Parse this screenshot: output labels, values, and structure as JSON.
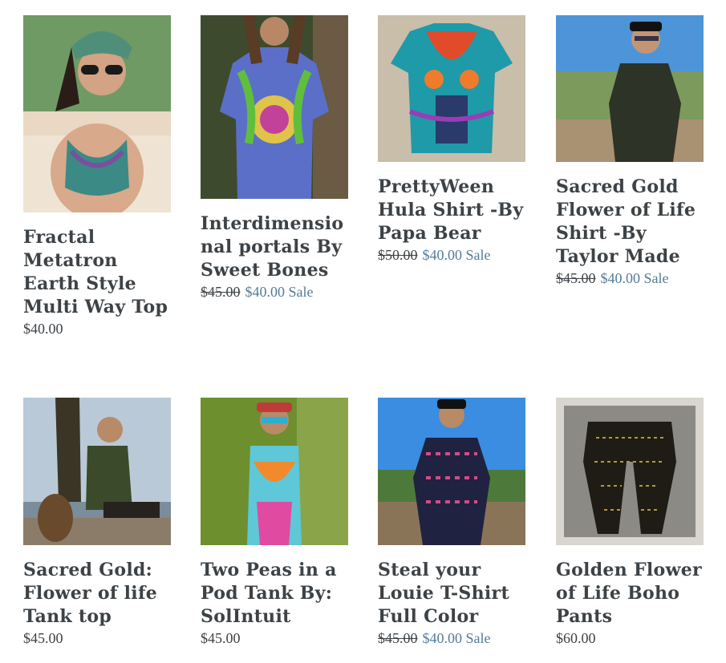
{
  "products": [
    {
      "title": "Fractal Metatron Earth Style Multi Way Top",
      "price": "$40.00"
    },
    {
      "title": "Interdimensional portals By Sweet Bones",
      "compare_price": "$45.00",
      "sale_price": "$40.00",
      "sale_label": "Sale"
    },
    {
      "title": "PrettyWeen Hula Shirt -By Papa Bear",
      "compare_price": "$50.00",
      "sale_price": "$40.00",
      "sale_label": "Sale"
    },
    {
      "title": "Sacred Gold Flower of Life Shirt -By Taylor Made",
      "compare_price": "$45.00",
      "sale_price": "$40.00",
      "sale_label": "Sale"
    },
    {
      "title": "Sacred Gold: Flower of life Tank top",
      "price": "$45.00"
    },
    {
      "title": "Two Peas in a Pod Tank By: SolIntuit",
      "price": "$45.00"
    },
    {
      "title": "Steal your Louie T-Shirt Full Color",
      "compare_price": "$45.00",
      "sale_price": "$40.00",
      "sale_label": "Sale"
    },
    {
      "title": "Golden Flower of Life Boho Pants",
      "price": "$60.00"
    }
  ],
  "colors": {
    "text": "#3d4246",
    "sale": "#557b97"
  }
}
